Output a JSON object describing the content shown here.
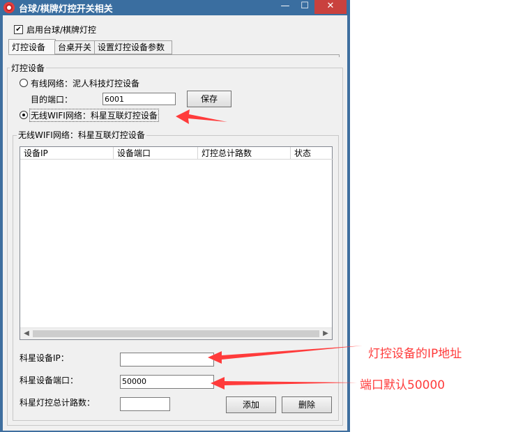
{
  "window": {
    "title": "台球/棋牌灯控开关相关",
    "minimize": "—",
    "maximize": "☐",
    "close": "✕"
  },
  "enable_checkbox": {
    "label": "启用台球/棋牌灯控",
    "checked": true
  },
  "tabs": [
    "灯控设备",
    "台桌开关",
    "设置灯控设备参数"
  ],
  "group_light": {
    "title": "灯控设备",
    "wired_radio": "有线网络：泥人科技灯控设备",
    "dest_port_label": "目的端口：",
    "dest_port_value": "6001",
    "save_button": "保存",
    "wifi_radio": "无线WIFI网络：科星互联灯控设备",
    "selected": "wifi"
  },
  "group_wifi": {
    "title": "无线WIFI网络：科星互联灯控设备",
    "columns": [
      "设备IP",
      "设备端口",
      "灯控总计路数",
      "状态"
    ],
    "rows": [],
    "kx_ip_label": "科星设备IP：",
    "kx_ip_value": "",
    "kx_port_label": "科星设备端口：",
    "kx_port_value": "50000",
    "kx_count_label": "科星灯控总计路数：",
    "kx_count_value": "",
    "add_button": "添加",
    "delete_button": "删除"
  },
  "annotations": {
    "ip_note": "灯控设备的IP地址",
    "port_note": "端口默认50000",
    "color": "#ff3b3b"
  },
  "colors": {
    "titlebar": "#3a6ea0",
    "close": "#c9413e",
    "panel": "#f0f0f0"
  }
}
